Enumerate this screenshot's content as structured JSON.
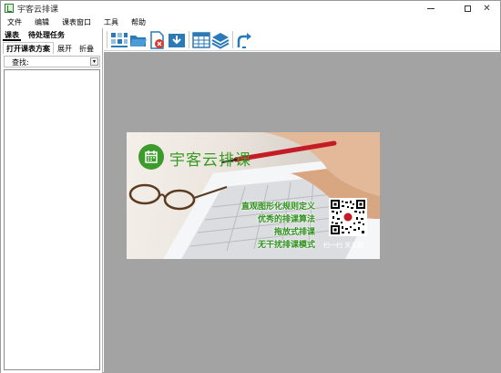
{
  "window": {
    "title": "宇客云排课",
    "controls": {
      "minimize": "minimize",
      "maximize": "maximize",
      "close": "✕"
    }
  },
  "menu": [
    "文件",
    "编辑",
    "课表窗口",
    "工具",
    "帮助"
  ],
  "left_panel": {
    "tabs": [
      "课表",
      "待处理任务"
    ],
    "subtabs": [
      "打开课表方案",
      "展开",
      "折叠"
    ],
    "search": {
      "label": "查找:",
      "value": "",
      "dropdown_glyph": "▾"
    }
  },
  "toolbar": {
    "buttons": [
      {
        "name": "grid-layout-icon",
        "color": "#2a7ab8"
      },
      {
        "name": "open-folder-icon",
        "color": "#2a7ab8"
      },
      {
        "name": "delete-file-icon",
        "color": "#d9372c"
      },
      {
        "name": "download-icon",
        "color": "#2a7ab8"
      },
      {
        "name": "table-icon",
        "color": "#2a7ab8"
      },
      {
        "name": "layers-icon",
        "color": "#2a7ab8"
      },
      {
        "name": "share-icon",
        "color": "#2a7ab8"
      }
    ]
  },
  "banner": {
    "logo_text": "宇客云排课",
    "features": [
      "直观图形化规则定义",
      "优秀的排课算法",
      "拖放式排课",
      "无干扰排课模式"
    ],
    "qr_caption": "扫一扫 关注我",
    "accent_color": "#3a9a26"
  },
  "colors": {
    "workspace": "#a3a3a3",
    "brand_green": "#3d9a2c"
  }
}
